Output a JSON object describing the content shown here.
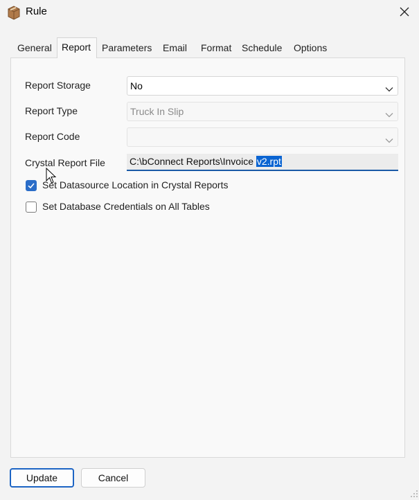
{
  "window": {
    "title": "Rule"
  },
  "tabs": [
    {
      "label": "General"
    },
    {
      "label": "Report"
    },
    {
      "label": "Parameters"
    },
    {
      "label": "Email"
    },
    {
      "label": "Format"
    },
    {
      "label": "Schedule"
    },
    {
      "label": "Options"
    }
  ],
  "active_tab": "Report",
  "fields": {
    "report_storage": {
      "label": "Report Storage",
      "value": "No"
    },
    "report_type": {
      "label": "Report Type",
      "value": "Truck In Slip"
    },
    "report_code": {
      "label": "Report Code",
      "value": ""
    },
    "crystal_report_file": {
      "label": "Crystal Report File",
      "value_unselected": "C:\\bConnect Reports\\Invoice ",
      "value_selected": "v2.rpt"
    }
  },
  "checkboxes": {
    "datasource": {
      "label": "Set Datasource Location in Crystal Reports",
      "checked": true
    },
    "credentials": {
      "label": "Set Database Credentials on All Tables",
      "checked": false
    }
  },
  "buttons": {
    "update": "Update",
    "cancel": "Cancel"
  },
  "colors": {
    "accent": "#1c64c4",
    "selection": "#0a64d2",
    "checkbox_checked": "#2a6dc8"
  },
  "icons": {
    "app": "box-icon",
    "close": "close-icon",
    "dropdown": "chevron-down-icon",
    "check": "checkmark-icon",
    "cursor": "mouse-pointer-icon",
    "resize": "resize-grip-icon"
  }
}
